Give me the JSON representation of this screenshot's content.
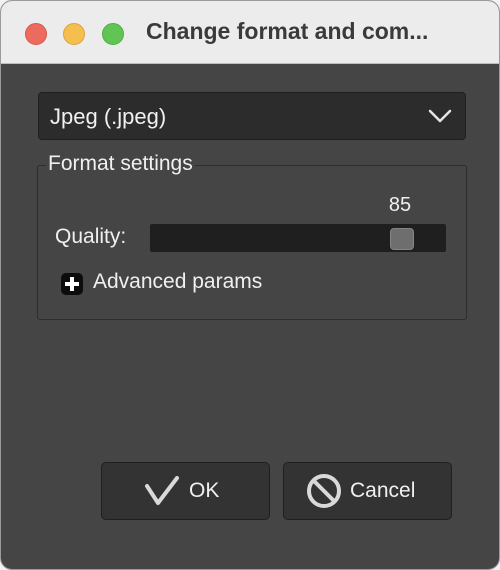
{
  "window": {
    "title": "Change format and com..."
  },
  "format_select": {
    "value": "Jpeg (.jpeg)"
  },
  "format_settings": {
    "legend": "Format settings",
    "quality": {
      "label": "Quality:",
      "value": "85",
      "fraction": 0.85
    },
    "advanced": {
      "label": "Advanced params"
    }
  },
  "buttons": {
    "ok": "OK",
    "cancel": "Cancel"
  },
  "icons": {
    "close": "close-traffic-light",
    "minimize": "minimize-traffic-light",
    "maximize": "maximize-traffic-light",
    "dropdown": "chevron-down-icon",
    "expand": "plus-icon",
    "ok": "checkmark-icon",
    "cancel": "prohibited-icon"
  },
  "colors": {
    "close": "#ed6a5e",
    "minimize": "#f5bf4f",
    "maximize": "#61c554",
    "panel": "#454545"
  }
}
